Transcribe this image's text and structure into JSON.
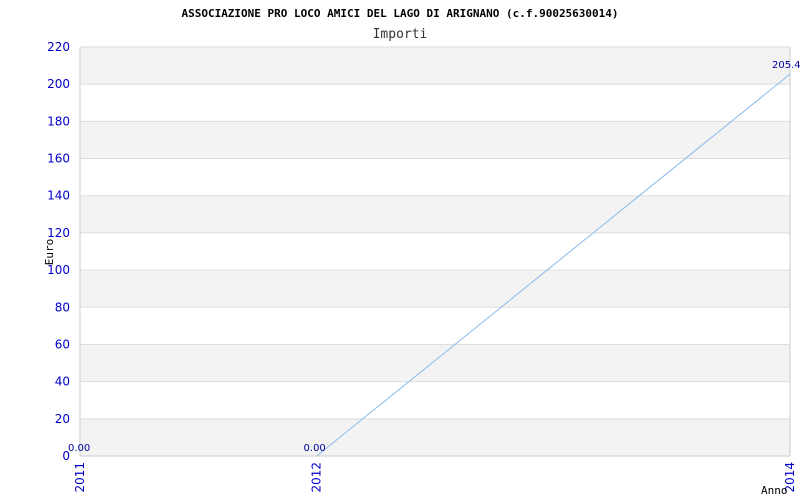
{
  "chart_data": {
    "type": "line",
    "title": "ASSOCIAZIONE PRO LOCO AMICI DEL LAGO DI ARIGNANO (c.f.90025630014)",
    "subtitle": "Importi",
    "xlabel": "Anno",
    "ylabel": "Euro",
    "x": [
      "2011",
      "2012",
      "2014"
    ],
    "values": [
      0.0,
      0.0,
      205.4
    ],
    "data_labels": [
      "0.00",
      "0.00",
      "205.4"
    ],
    "ylim": [
      0,
      220
    ],
    "yticks": [
      0,
      20,
      40,
      60,
      80,
      100,
      120,
      140,
      160,
      180,
      200,
      220
    ],
    "grid": true,
    "line_color": "#88bbee",
    "tick_color": "#0000cc",
    "band_color": "#f3f3f3"
  }
}
